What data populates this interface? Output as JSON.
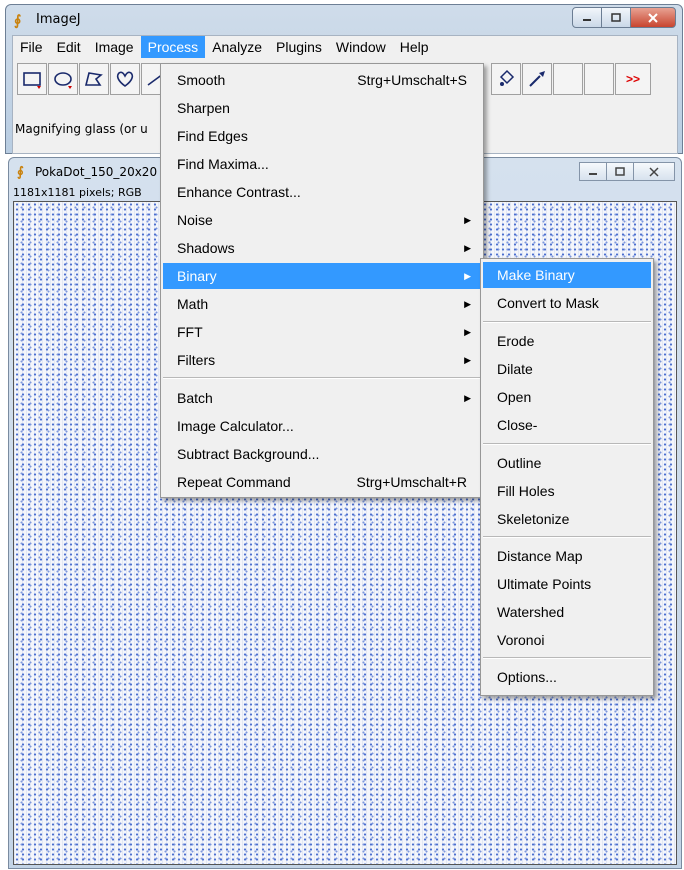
{
  "main_window": {
    "title": "ImageJ",
    "menus": [
      "File",
      "Edit",
      "Image",
      "Process",
      "Analyze",
      "Plugins",
      "Window",
      "Help"
    ],
    "status": "Magnifying glass (or u"
  },
  "toolbar": {
    "tools": [
      "rectangle-tool-icon",
      "oval-tool-icon",
      "polygon-tool-icon",
      "freehand-tool-icon",
      "line-tool-icon"
    ],
    "right_tools": [
      "flood-fill-icon",
      "pick-color-icon",
      "empty-tool",
      "empty-tool"
    ],
    "more_label": ">>"
  },
  "image_window": {
    "title": "PokaDot_150_20x20",
    "info": "1181x1181 pixels; RGB"
  },
  "process_menu": {
    "items": [
      {
        "label": "Smooth",
        "shortcut": "Strg+Umschalt+S"
      },
      {
        "label": "Sharpen"
      },
      {
        "label": "Find Edges"
      },
      {
        "label": "Find Maxima..."
      },
      {
        "label": "Enhance Contrast..."
      },
      {
        "label": "Noise",
        "submenu": true
      },
      {
        "label": "Shadows",
        "submenu": true
      },
      {
        "label": "Binary",
        "submenu": true,
        "highlighted": true
      },
      {
        "label": "Math",
        "submenu": true
      },
      {
        "label": "FFT",
        "submenu": true
      },
      {
        "label": "Filters",
        "submenu": true
      },
      {
        "label": "Batch",
        "submenu": true
      },
      {
        "label": "Image Calculator..."
      },
      {
        "label": "Subtract Background..."
      },
      {
        "label": "Repeat Command",
        "shortcut": "Strg+Umschalt+R"
      }
    ]
  },
  "binary_menu": {
    "items": [
      "Make Binary",
      "Convert to Mask",
      "Erode",
      "Dilate",
      "Open",
      "Close-",
      "Outline",
      "Fill Holes",
      "Skeletonize",
      "Distance Map",
      "Ultimate Points",
      "Watershed",
      "Voronoi",
      "Options..."
    ]
  },
  "colors": {
    "highlight": "#3399ff",
    "menu_bg": "#f0f0f0",
    "dots": "#4b6fd0"
  }
}
